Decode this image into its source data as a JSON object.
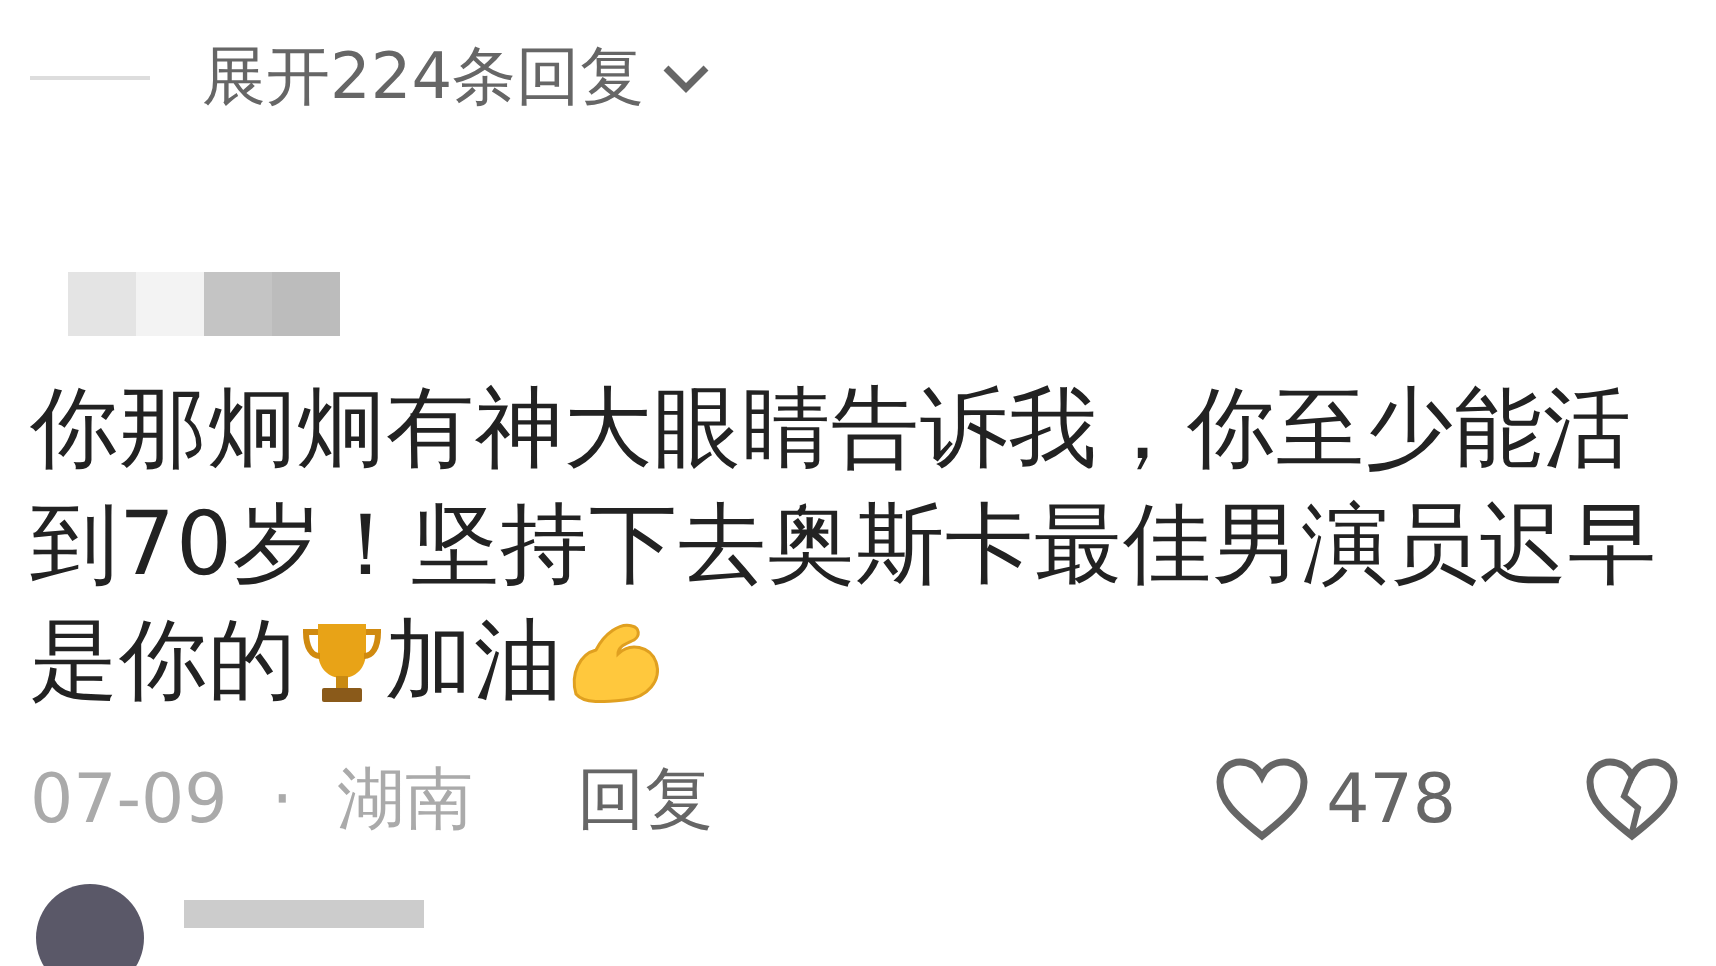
{
  "expand_replies": {
    "label": "展开224条回复"
  },
  "comment": {
    "segments": [
      {
        "kind": "text",
        "text": "你那炯炯有神大眼睛告诉我，你至少能活"
      },
      {
        "kind": "text",
        "text": "到70岁！坚持下去奥斯卡最佳男演员迟早"
      },
      {
        "kind": "text",
        "text": "是你的"
      },
      {
        "kind": "trophy"
      },
      {
        "kind": "text",
        "text": "加油"
      },
      {
        "kind": "flex"
      }
    ],
    "date": "07-09",
    "separator": "·",
    "location": "湖南",
    "reply": "回复",
    "likes": "478",
    "liked": false
  }
}
